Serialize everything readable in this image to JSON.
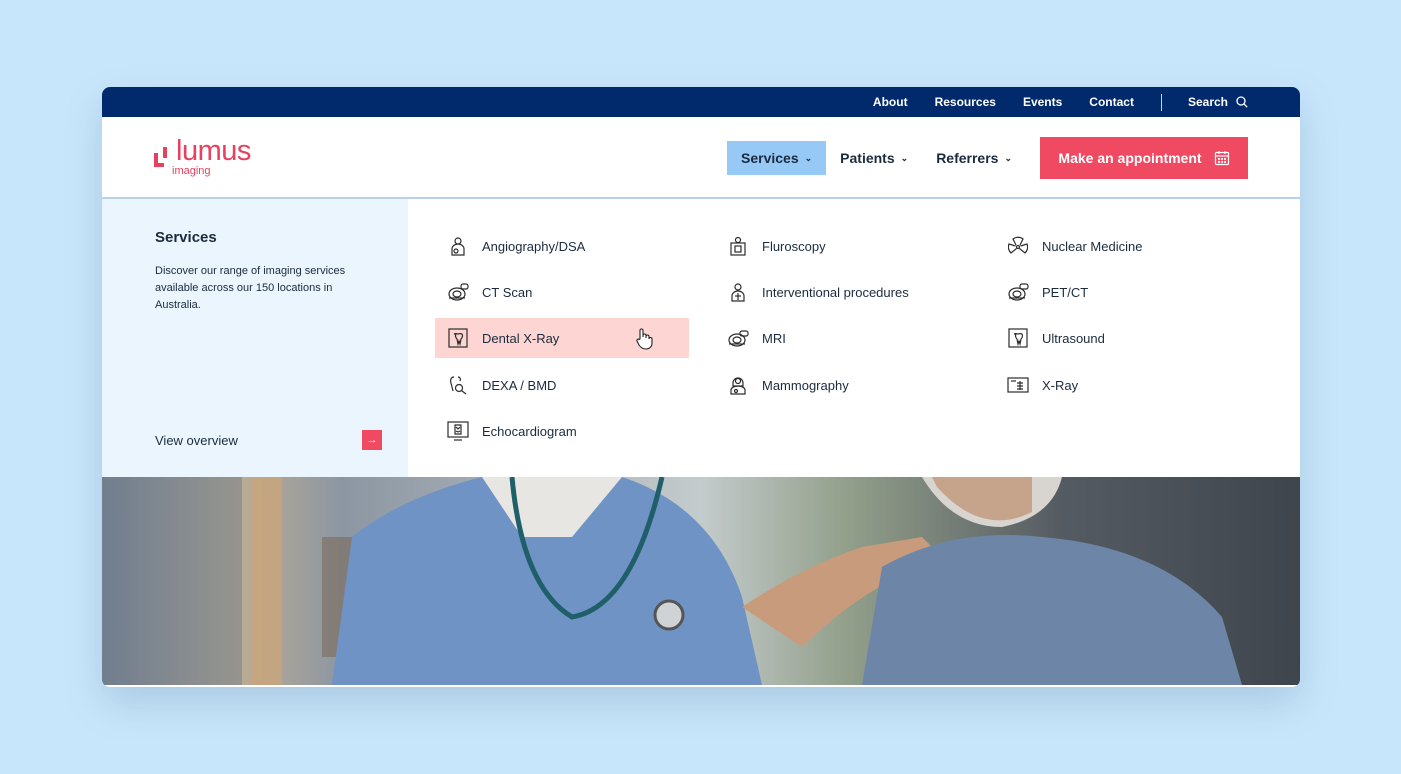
{
  "utility_nav": {
    "items": [
      "About",
      "Resources",
      "Events",
      "Contact"
    ],
    "search_label": "Search"
  },
  "logo": {
    "word": "lumus",
    "sub": "imaging"
  },
  "main_nav": {
    "items": [
      {
        "label": "Services",
        "active": true
      },
      {
        "label": "Patients",
        "active": false
      },
      {
        "label": "Referrers",
        "active": false
      }
    ],
    "cta_label": "Make an appointment"
  },
  "mega_menu": {
    "title": "Services",
    "description": "Discover our range of imaging services available across our 150 locations in Australia.",
    "overview_label": "View overview",
    "overview_arrow": "→",
    "columns": [
      [
        {
          "label": "Angiography/DSA",
          "icon": "angiography-icon"
        },
        {
          "label": "CT Scan",
          "icon": "ct-scan-icon"
        },
        {
          "label": "Dental X-Ray",
          "icon": "dental-xray-icon",
          "hovered": true
        },
        {
          "label": "DEXA / BMD",
          "icon": "dexa-icon"
        },
        {
          "label": "Echocardiogram",
          "icon": "echocardiogram-icon"
        }
      ],
      [
        {
          "label": "Fluroscopy",
          "icon": "fluroscopy-icon"
        },
        {
          "label": "Interventional procedures",
          "icon": "interventional-icon"
        },
        {
          "label": "MRI",
          "icon": "mri-icon"
        },
        {
          "label": "Mammography",
          "icon": "mammography-icon"
        }
      ],
      [
        {
          "label": "Nuclear Medicine",
          "icon": "nuclear-medicine-icon"
        },
        {
          "label": "PET/CT",
          "icon": "pet-ct-icon"
        },
        {
          "label": "Ultrasound",
          "icon": "ultrasound-icon"
        },
        {
          "label": "X-Ray",
          "icon": "xray-icon"
        }
      ]
    ]
  },
  "colors": {
    "background": "#c8e6fb",
    "utility_bar": "#012a6c",
    "brand": "#f04a63",
    "active_nav": "#96c9f5",
    "hover_item": "#fdd5d3",
    "panel": "#eaf5fe"
  }
}
